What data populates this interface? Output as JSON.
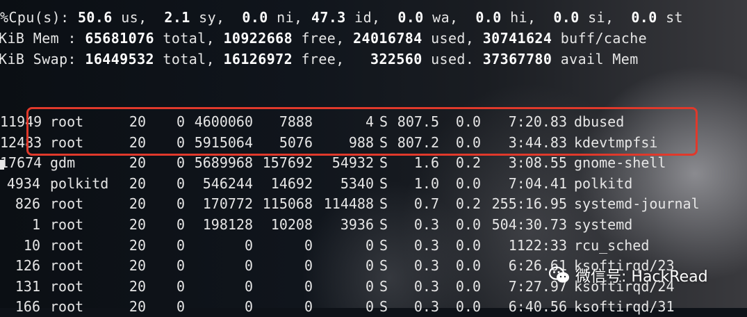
{
  "summary": {
    "cpu_fragment": "%Cpu(s): ",
    "cpu_us": "50.6",
    "cpu_sy": "2.1",
    "cpu_ni": "0.0",
    "cpu_id": "47.3",
    "cpu_wa": "0.0",
    "cpu_hi": "0.0",
    "cpu_si": "0.0",
    "cpu_st": "0.0",
    "mem_prefix": "KiB Mem : ",
    "mem_total": "65681076",
    "mem_free": "10922668",
    "mem_used": "24016784",
    "mem_buff": "30741624",
    "swap_prefix": "KiB Swap: ",
    "swap_total": "16449532",
    "swap_free": "16126972",
    "swap_used": "322560",
    "swap_avail": "37367780"
  },
  "processes": [
    {
      "pid": "11949",
      "user": "root",
      "pr": "20",
      "ni": "0",
      "virt": "4600060",
      "res": "7888",
      "shr": "4",
      "s": "S",
      "cpu": "807.5",
      "mem": "0.0",
      "time": "7:20.83",
      "cmd": "dbused"
    },
    {
      "pid": "12483",
      "user": "root",
      "pr": "20",
      "ni": "0",
      "virt": "5915064",
      "res": "5076",
      "shr": "988",
      "s": "S",
      "cpu": "807.2",
      "mem": "0.0",
      "time": "3:44.83",
      "cmd": "kdevtmpfsi"
    },
    {
      "pid": "17674",
      "user": "gdm",
      "pr": "20",
      "ni": "0",
      "virt": "5689968",
      "res": "157692",
      "shr": "54932",
      "s": "S",
      "cpu": "1.6",
      "mem": "0.2",
      "time": "3:08.55",
      "cmd": "gnome-shell"
    },
    {
      "pid": "4934",
      "user": "polkitd",
      "pr": "20",
      "ni": "0",
      "virt": "546244",
      "res": "14692",
      "shr": "5340",
      "s": "S",
      "cpu": "1.0",
      "mem": "0.0",
      "time": "7:04.41",
      "cmd": "polkitd"
    },
    {
      "pid": "826",
      "user": "root",
      "pr": "20",
      "ni": "0",
      "virt": "170772",
      "res": "115068",
      "shr": "114488",
      "s": "S",
      "cpu": "0.7",
      "mem": "0.2",
      "time": "255:16.95",
      "cmd": "systemd-journal"
    },
    {
      "pid": "1",
      "user": "root",
      "pr": "20",
      "ni": "0",
      "virt": "198128",
      "res": "10208",
      "shr": "3936",
      "s": "S",
      "cpu": "0.3",
      "mem": "0.0",
      "time": "504:30.73",
      "cmd": "systemd"
    },
    {
      "pid": "10",
      "user": "root",
      "pr": "20",
      "ni": "0",
      "virt": "0",
      "res": "0",
      "shr": "0",
      "s": "S",
      "cpu": "0.3",
      "mem": "0.0",
      "time": "1122:33",
      "cmd": "rcu_sched"
    },
    {
      "pid": "126",
      "user": "root",
      "pr": "20",
      "ni": "0",
      "virt": "0",
      "res": "0",
      "shr": "0",
      "s": "S",
      "cpu": "0.3",
      "mem": "0.0",
      "time": "6:26.61",
      "cmd": "ksoftirqd/23"
    },
    {
      "pid": "131",
      "user": "root",
      "pr": "20",
      "ni": "0",
      "virt": "0",
      "res": "0",
      "shr": "0",
      "s": "S",
      "cpu": "0.3",
      "mem": "0.0",
      "time": "7:27.97",
      "cmd": "ksoftirqd/24"
    },
    {
      "pid": "166",
      "user": "root",
      "pr": "20",
      "ni": "0",
      "virt": "0",
      "res": "0",
      "shr": "0",
      "s": "S",
      "cpu": "0.3",
      "mem": "0.0",
      "time": "6:40.56",
      "cmd": "ksoftirqd/31"
    }
  ],
  "watermark": {
    "text": "微信号: HackRead",
    "icon": "wechat-icon"
  },
  "colors": {
    "highlight": "#e0392b",
    "text": "#e6e6e6"
  }
}
